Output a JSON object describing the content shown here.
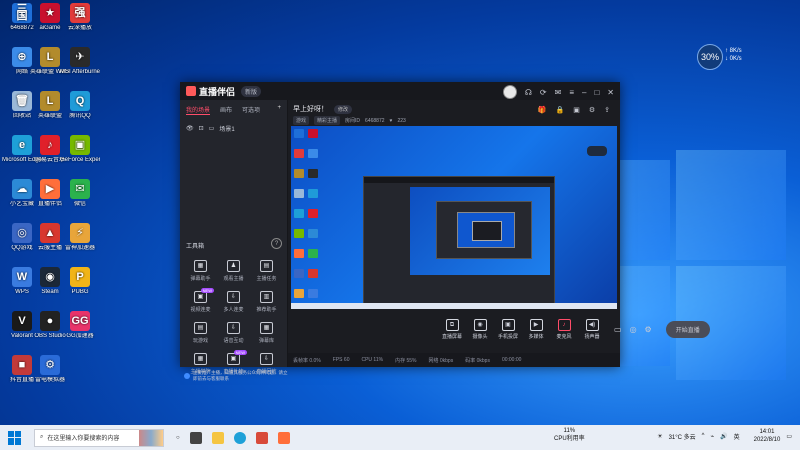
{
  "desktop": {
    "icons": [
      {
        "label": "6468872",
        "color": "#1e6fd9",
        "glyph": "三国"
      },
      {
        "label": "aiGame",
        "color": "#c8102e",
        "glyph": "★"
      },
      {
        "label": "云深播放",
        "color": "#e23b3b",
        "glyph": "强"
      },
      {
        "label": "网络",
        "color": "#3b8be8",
        "glyph": "⊕"
      },
      {
        "label": "英雄联盟 WeGame版",
        "color": "#b28b2c",
        "glyph": "L"
      },
      {
        "label": "MSI Afterburner",
        "color": "#2a2a2a",
        "glyph": "✈"
      },
      {
        "label": "回收站",
        "color": "#9ab8d8",
        "glyph": "🗑"
      },
      {
        "label": "英雄联盟",
        "color": "#b28b2c",
        "glyph": "L"
      },
      {
        "label": "腾讯QQ",
        "color": "#1f9bd8",
        "glyph": "Q"
      },
      {
        "label": "Microsoft Edge",
        "color": "#1ea0d8",
        "glyph": "e"
      },
      {
        "label": "网易云音乐",
        "color": "#e0202a",
        "glyph": "♪"
      },
      {
        "label": "GeForce Experience",
        "color": "#76b900",
        "glyph": "▣"
      },
      {
        "label": "小艺宝藏",
        "color": "#2c8ad6",
        "glyph": "☁"
      },
      {
        "label": "直播伴侣",
        "color": "#ff6e3a",
        "glyph": "▶"
      },
      {
        "label": "微信",
        "color": "#2bb24c",
        "glyph": "✉"
      },
      {
        "label": "QQ游戏",
        "color": "#3a66c4",
        "glyph": "◎"
      },
      {
        "label": "云服主播",
        "color": "#d8372e",
        "glyph": "▲"
      },
      {
        "label": "雷神加速器",
        "color": "#e8a53a",
        "glyph": "⚡"
      },
      {
        "label": "WPS",
        "color": "#3a7be0",
        "glyph": "W"
      },
      {
        "label": "Steam",
        "color": "#1b2838",
        "glyph": "◉"
      },
      {
        "label": "PUBG",
        "color": "#f0b418",
        "glyph": "P"
      },
      {
        "label": "Valorant",
        "color": "#1a1a1a",
        "glyph": "V"
      },
      {
        "label": "OBS Studio",
        "color": "#222",
        "glyph": "●"
      },
      {
        "label": "GG加速器",
        "color": "#e8336a",
        "glyph": "GG"
      },
      {
        "label": "抖音直播",
        "color": "#c23a3a",
        "glyph": "■"
      },
      {
        "label": "雷电模拟器",
        "color": "#2a6bd8",
        "glyph": "⚙"
      }
    ]
  },
  "weather_widget": {
    "temp": "30",
    "unit": "%",
    "up": "8K/s",
    "down": "0K/s"
  },
  "app": {
    "name": "直播伴侣",
    "version": "新版",
    "tabs": [
      "我的场景",
      "画布",
      "可选项"
    ],
    "active_tab": "我的场景",
    "scene_name": "场景1",
    "toolbox_title": "工具箱",
    "toolbox_help": "?",
    "tools": [
      {
        "label": "弹幕助手",
        "icon": "▦",
        "badge": ""
      },
      {
        "label": "观看主播",
        "icon": "♟",
        "badge": ""
      },
      {
        "label": "主播任务",
        "icon": "▤",
        "badge": ""
      },
      {
        "label": "视频连麦",
        "icon": "▣",
        "badge": "NEW"
      },
      {
        "label": "多人连麦",
        "icon": "⇩",
        "badge": ""
      },
      {
        "label": "推荐助手",
        "icon": "▥",
        "badge": ""
      },
      {
        "label": "玩游戏",
        "icon": "▤",
        "badge": ""
      },
      {
        "label": "语音互动",
        "icon": "⇩",
        "badge": ""
      },
      {
        "label": "弹幕库",
        "icon": "▦",
        "badge": ""
      },
      {
        "label": "主播学院",
        "icon": "▦",
        "badge": ""
      },
      {
        "label": "直播礼物",
        "icon": "▣",
        "badge": "NEW"
      },
      {
        "label": "直播回放",
        "icon": "⇩",
        "badge": ""
      }
    ],
    "stream_title": "早上好呀！",
    "edit_label": "修改",
    "meta": {
      "tag1": "游戏",
      "tag2": "精彩主播",
      "id_label": "房间ID",
      "id": "6468872",
      "fans": "223"
    },
    "controls": [
      {
        "label": "直播屏幕",
        "icon": "⧉"
      },
      {
        "label": "摄像头",
        "icon": "◉"
      },
      {
        "label": "手机投屏",
        "icon": "▣"
      },
      {
        "label": "多媒体",
        "icon": "▶"
      },
      {
        "label": "麦克风",
        "icon": "♪",
        "red": true
      },
      {
        "label": "扬声器",
        "icon": "◀)"
      }
    ],
    "start_live": "开始直播",
    "status": [
      "丢帧率 0.0%",
      "FPS 60",
      "CPU 11%",
      "内存 55%",
      "网络 0kbps",
      "码率 0kbps",
      "00:00:00"
    ],
    "notice": "主要推广主播，知道其服务公众何种问题，请立即前去与客服联系"
  },
  "taskbar": {
    "search_placeholder": "在这里输入你要搜索的内容",
    "cpu_value": "11%",
    "cpu_label": "CPU利用率",
    "weather": "31°C 多云",
    "ime": "英",
    "time": "14:01",
    "date": "2022/8/10"
  }
}
